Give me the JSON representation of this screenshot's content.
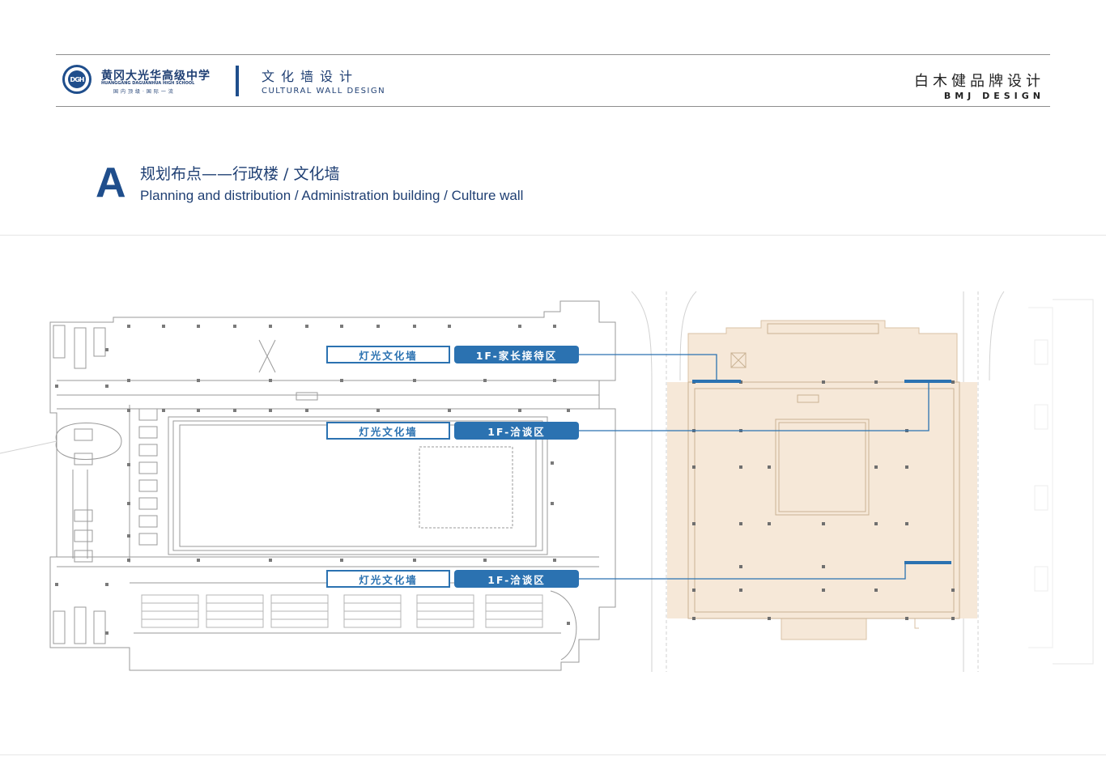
{
  "header": {
    "school_name_cn": "黄冈大光华高级中学",
    "school_name_en": "HUANGGANG DAGUANHUA HIGH SCHOOL",
    "school_slogan": "国内顶级·国际一流",
    "logo_text": "DGH",
    "project_title_cn": "文化墙设计",
    "project_title_en": "CULTURAL WALL DESIGN",
    "brand_cn": "白木健品牌设计",
    "brand_en": "BMJ DESIGN"
  },
  "section": {
    "letter": "A",
    "title_cn": "规划布点——行政楼 / 文化墙",
    "title_en": "Planning and distribution / Administration building / Culture wall"
  },
  "callouts": [
    {
      "type_label": "灯光文化墙",
      "area_label": "1F-家长接待区"
    },
    {
      "type_label": "灯光文化墙",
      "area_label": "1F-洽谈区"
    },
    {
      "type_label": "灯光文化墙",
      "area_label": "1F-洽谈区"
    }
  ],
  "colors": {
    "accent_blue": "#2b72b1",
    "navy": "#1f3f73",
    "highlight_area": "#f6e8d8"
  }
}
